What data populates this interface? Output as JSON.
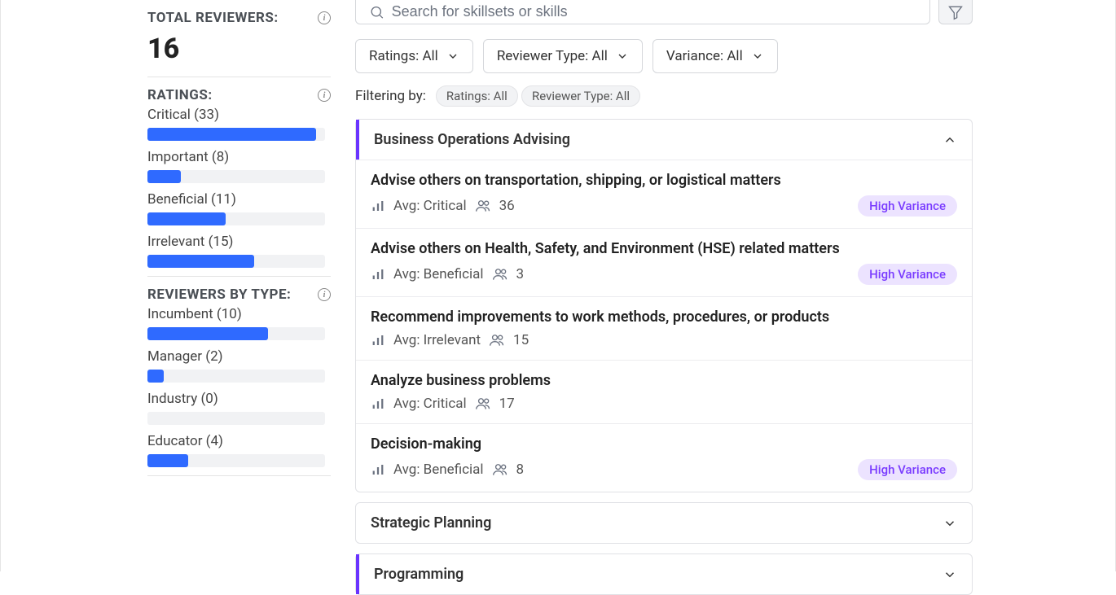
{
  "sidebar": {
    "total_reviewers_label": "TOTAL REVIEWERS:",
    "total_reviewers_value": "16",
    "ratings_label": "RATINGS:",
    "ratings": [
      {
        "label": "Critical (33)",
        "pct": 95
      },
      {
        "label": "Important (8)",
        "pct": 19
      },
      {
        "label": "Beneficial (11)",
        "pct": 44
      },
      {
        "label": "Irrelevant (15)",
        "pct": 60
      }
    ],
    "reviewers_by_type_label": "REVIEWERS BY TYPE:",
    "reviewers": [
      {
        "label": "Incumbent (10)",
        "pct": 68
      },
      {
        "label": "Manager (2)",
        "pct": 9
      },
      {
        "label": "Industry (0)",
        "pct": 0
      },
      {
        "label": "Educator (4)",
        "pct": 23
      }
    ]
  },
  "search": {
    "placeholder": "Search for skillsets or skills"
  },
  "filters": {
    "ratings": "Ratings: All",
    "reviewer_type": "Reviewer Type: All",
    "variance": "Variance: All",
    "filtering_by_label": "Filtering by:",
    "pills": [
      "Ratings: All",
      "Reviewer Type: All"
    ]
  },
  "groups": [
    {
      "title": "Business Operations Advising",
      "expanded": true,
      "accent": true,
      "items": [
        {
          "title": "Advise others on transportation, shipping, or logistical matters",
          "avg": "Avg: Critical",
          "count": "36",
          "variance": "High Variance"
        },
        {
          "title": "Advise others on Health, Safety, and Environment (HSE) related matters",
          "avg": "Avg: Beneficial",
          "count": "3",
          "variance": "High Variance"
        },
        {
          "title": "Recommend improvements to work methods, procedures, or products",
          "avg": "Avg: Irrelevant",
          "count": "15",
          "variance": ""
        },
        {
          "title": "Analyze business problems",
          "avg": "Avg: Critical",
          "count": "17",
          "variance": ""
        },
        {
          "title": "Decision-making",
          "avg": "Avg: Beneficial",
          "count": "8",
          "variance": "High Variance"
        }
      ]
    },
    {
      "title": "Strategic Planning",
      "expanded": false,
      "accent": false,
      "items": []
    },
    {
      "title": "Programming",
      "expanded": false,
      "accent": true,
      "items": []
    }
  ]
}
